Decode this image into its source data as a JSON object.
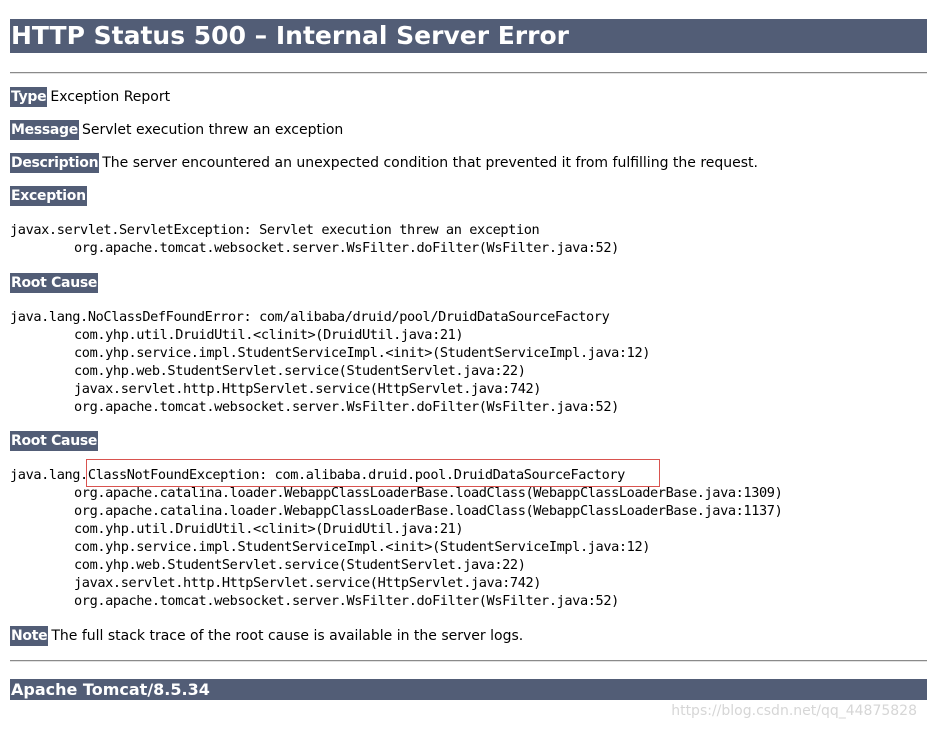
{
  "title": "HTTP Status 500 – Internal Server Error",
  "sections": {
    "type": {
      "label": "Type",
      "text": "Exception Report"
    },
    "message": {
      "label": "Message",
      "text": "Servlet execution threw an exception"
    },
    "description": {
      "label": "Description",
      "text": "The server encountered an unexpected condition that prevented it from fulfilling the request."
    },
    "exception": {
      "label": "Exception"
    },
    "root_cause_1": {
      "label": "Root Cause"
    },
    "root_cause_2": {
      "label": "Root Cause"
    },
    "note": {
      "label": "Note",
      "text": "The full stack trace of the root cause is available in the server logs."
    }
  },
  "exception_trace": {
    "head": "javax.servlet.ServletException: Servlet execution threw an exception",
    "frames": [
      "org.apache.tomcat.websocket.server.WsFilter.doFilter(WsFilter.java:52)"
    ]
  },
  "root_cause_1_trace": {
    "head": "java.lang.NoClassDefFoundError: com/alibaba/druid/pool/DruidDataSourceFactory",
    "frames": [
      "com.yhp.util.DruidUtil.<clinit>(DruidUtil.java:21)",
      "com.yhp.service.impl.StudentServiceImpl.<init>(StudentServiceImpl.java:12)",
      "com.yhp.web.StudentServlet.service(StudentServlet.java:22)",
      "javax.servlet.http.HttpServlet.service(HttpServlet.java:742)",
      "org.apache.tomcat.websocket.server.WsFilter.doFilter(WsFilter.java:52)"
    ]
  },
  "root_cause_2_trace": {
    "head_prefix": "java.lang.",
    "head_highlighted": "ClassNotFoundException: com.alibaba.druid.pool.DruidDataSourceFactory",
    "frames": [
      "org.apache.catalina.loader.WebappClassLoaderBase.loadClass(WebappClassLoaderBase.java:1309)",
      "org.apache.catalina.loader.WebappClassLoaderBase.loadClass(WebappClassLoaderBase.java:1137)",
      "com.yhp.util.DruidUtil.<clinit>(DruidUtil.java:21)",
      "com.yhp.service.impl.StudentServiceImpl.<init>(StudentServiceImpl.java:12)",
      "com.yhp.web.StudentServlet.service(StudentServlet.java:22)",
      "javax.servlet.http.HttpServlet.service(HttpServlet.java:742)",
      "org.apache.tomcat.websocket.server.WsFilter.doFilter(WsFilter.java:52)"
    ]
  },
  "footer": "Apache Tomcat/8.5.34",
  "watermark": "https://blog.csdn.net/qq_44875828",
  "colors": {
    "header_bg": "#525d76",
    "header_text": "#ffffff",
    "highlight_border": "#d9534f"
  }
}
